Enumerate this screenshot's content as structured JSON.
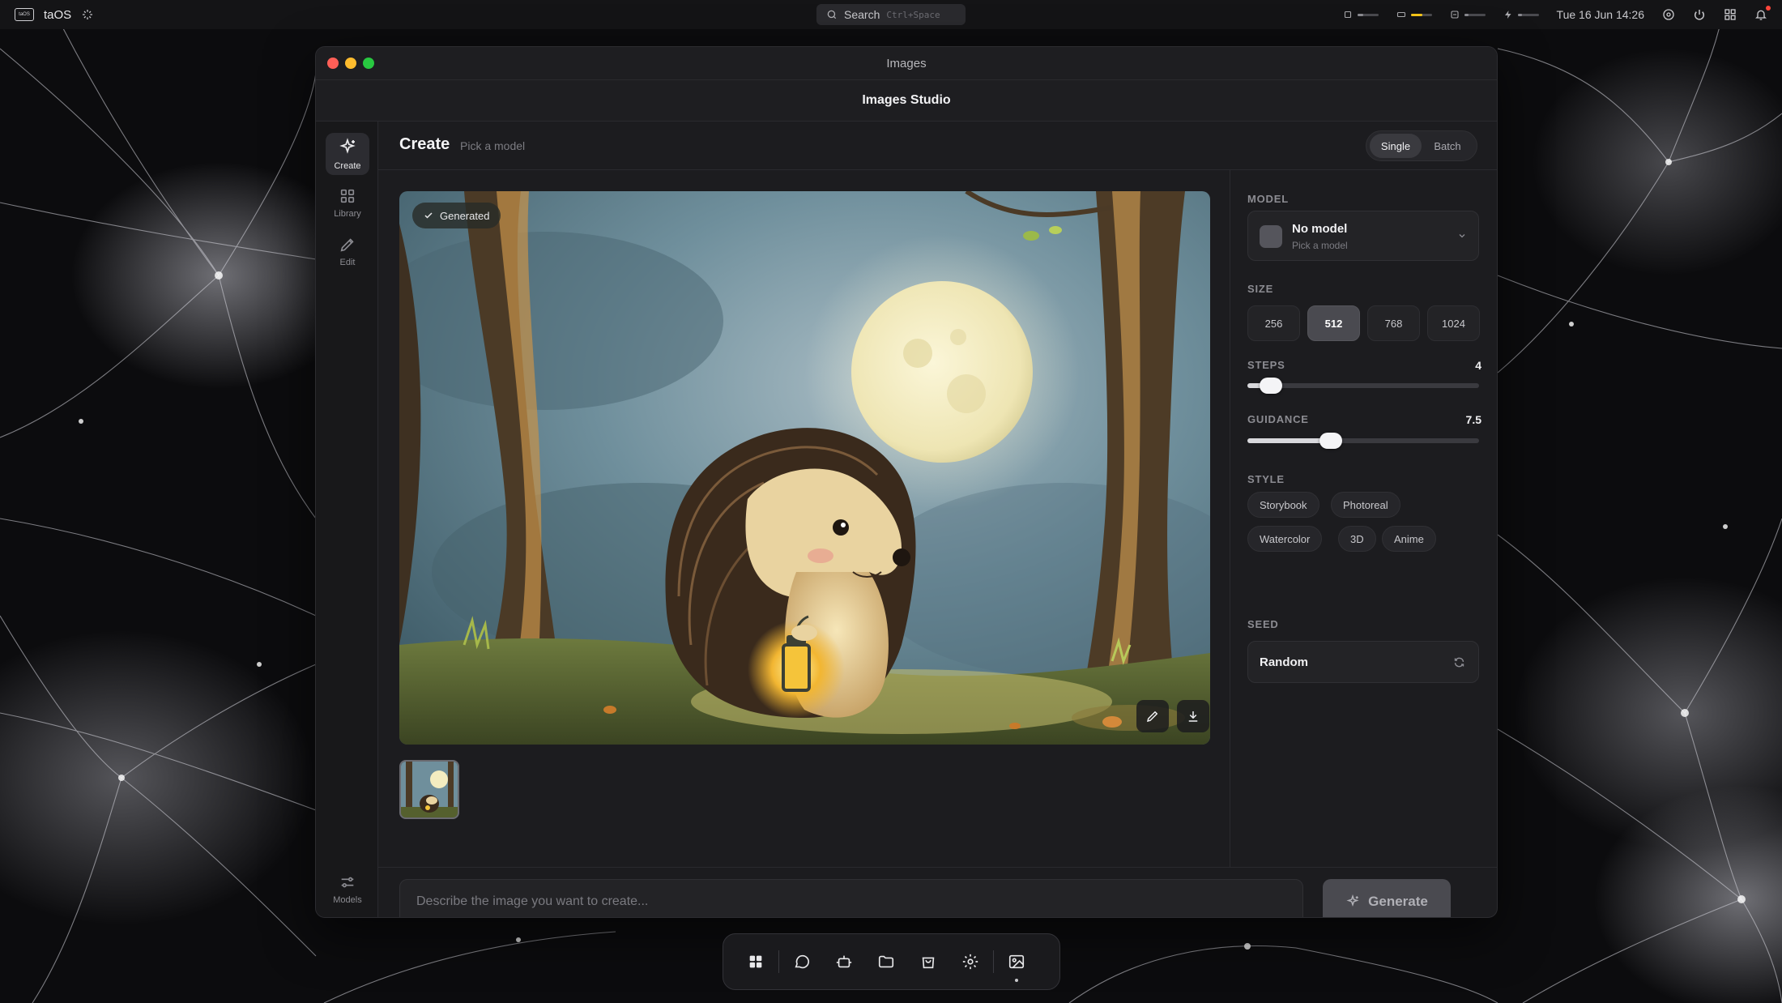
{
  "menubar": {
    "os_name": "taOS",
    "os_logo_text": "taOS",
    "search_label": "Search",
    "search_shortcut": "Ctrl+Space",
    "datetime": "Tue 16 Jun 14:26",
    "meters": [
      {
        "icon": "cpu-icon",
        "level": 0.3
      },
      {
        "icon": "memory-icon",
        "level": 0.55,
        "color": "#f5c518"
      },
      {
        "icon": "disk-icon",
        "level": 0.2
      },
      {
        "icon": "power-icon",
        "level": 0.2
      }
    ]
  },
  "window": {
    "title": "Images",
    "studio_title": "Images Studio"
  },
  "rail": {
    "items": [
      {
        "label": "Create",
        "icon": "sparkle-icon",
        "active": true
      },
      {
        "label": "Library",
        "icon": "grid-icon"
      },
      {
        "label": "Edit",
        "icon": "pencil-icon"
      }
    ],
    "bottom": {
      "label": "Models",
      "icon": "sliders-icon"
    }
  },
  "create": {
    "title": "Create",
    "subtitle": "Pick a model",
    "modes": [
      "Single",
      "Batch"
    ],
    "active_mode": "Single"
  },
  "canvas": {
    "badge": "Generated"
  },
  "panel": {
    "model_label": "MODEL",
    "model_name": "No model",
    "model_sub": "Pick a model",
    "size_label": "SIZE",
    "sizes": [
      "256",
      "512",
      "768",
      "1024"
    ],
    "active_size": "512",
    "steps_label": "STEPS",
    "steps_value": "4",
    "steps_fraction": 0.1,
    "guidance_label": "GUIDANCE",
    "guidance_value": "7.5",
    "guidance_fraction": 0.36,
    "style_label": "STYLE",
    "styles": [
      "Storybook",
      "Photoreal",
      "Watercolor",
      "3D",
      "Anime"
    ],
    "seed_label": "SEED",
    "seed_value": "Random"
  },
  "prompt": {
    "placeholder": "Describe the image you want to create...",
    "value": ""
  },
  "generate_label": "Generate",
  "dock": {
    "items": [
      "apps-grid-icon",
      "chat-icon",
      "robot-icon",
      "folder-icon",
      "store-bag-icon",
      "settings-gear-icon",
      "images-icon"
    ]
  },
  "colors": {
    "close": "#ff5f57",
    "minimize": "#febc2e",
    "zoom": "#28c840"
  }
}
